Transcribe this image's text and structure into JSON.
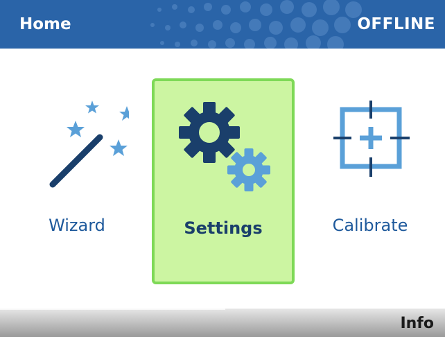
{
  "header": {
    "title": "Home",
    "status": "OFFLINE",
    "color": "#2a64a8"
  },
  "menu": {
    "items": [
      {
        "label": "Wizard",
        "icon": "magic-wand-icon",
        "selected": false
      },
      {
        "label": "Settings",
        "icon": "gears-icon",
        "selected": true
      },
      {
        "label": "Calibrate",
        "icon": "crosshair-icon",
        "selected": false
      }
    ]
  },
  "footer": {
    "info_label": "Info"
  },
  "colors": {
    "accent_dark": "#1a3f6b",
    "accent_light": "#5aa0d8",
    "selected_bg": "#ccf5a2",
    "selected_border": "#7ed957"
  }
}
